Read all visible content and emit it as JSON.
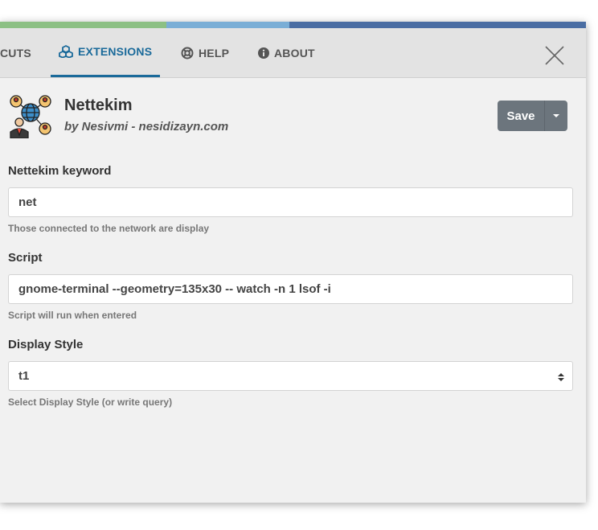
{
  "colors": {
    "accent_green": "#8cc084",
    "accent_lightblue": "#7aaed6",
    "accent_blue": "#4a6da3",
    "tab_active": "#1a6a9a",
    "save_bg": "#6c757d"
  },
  "tabs": [
    {
      "label": "CUTS",
      "icon": null
    },
    {
      "label": "EXTENSIONS",
      "icon": "cubes-icon",
      "active": true
    },
    {
      "label": "HELP",
      "icon": "life-ring-icon"
    },
    {
      "label": "ABOUT",
      "icon": "info-circle-icon"
    }
  ],
  "plugin": {
    "icon": "network-people-icon",
    "title": "Nettekim",
    "author": "by Nesivmi - nesidizayn.com"
  },
  "save": {
    "label": "Save",
    "caret_icon": "caret-down-icon"
  },
  "fields": {
    "keyword": {
      "label": "Nettekim keyword",
      "value": "net",
      "help": "Those connected to the network are display"
    },
    "script": {
      "label": "Script",
      "value": "gnome-terminal --geometry=135x30 -- watch -n 1 lsof -i",
      "help": "Script will run when entered"
    },
    "display_style": {
      "label": "Display Style",
      "value": "t1",
      "help": "Select Display Style (or write query)"
    }
  }
}
